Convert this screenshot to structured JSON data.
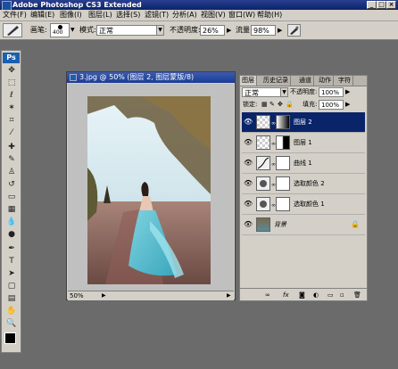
{
  "window": {
    "title": "Adobe Photoshop CS3 Extended"
  },
  "menu": [
    "文件(F)",
    "编辑(E)",
    "图像(I)",
    "图层(L)",
    "选择(S)",
    "滤镜(T)",
    "分析(A)",
    "视图(V)",
    "窗口(W)",
    "帮助(H)"
  ],
  "options": {
    "brush_label": "画笔:",
    "brush_size": "400",
    "mode_label": "模式:",
    "mode_value": "正常",
    "opacity_label": "不透明度:",
    "opacity_value": "26%",
    "flow_label": "流量:",
    "flow_value": "98%"
  },
  "toolbox": {
    "logo": "Ps"
  },
  "document": {
    "title": "3.jpg @ 50% (图层 2, 图层蒙版/8)",
    "zoom": "50%"
  },
  "layers_panel": {
    "tabs": [
      "图层",
      "历史记录",
      "通道",
      "动作",
      "字符"
    ],
    "blend_mode": "正常",
    "opacity_label": "不透明度:",
    "opacity_value": "100%",
    "lock_label": "锁定:",
    "fill_label": "填充:",
    "fill_value": "100%",
    "layers": [
      {
        "name": "图层 2",
        "selected": true
      },
      {
        "name": "图层 1",
        "selected": false
      },
      {
        "name": "曲线 1",
        "selected": false
      },
      {
        "name": "选取颜色 2",
        "selected": false
      },
      {
        "name": "选取颜色 1",
        "selected": false
      },
      {
        "name": "背景",
        "selected": false
      }
    ]
  },
  "colors": {
    "title_bar": "#0a246a",
    "selected_layer": "#0a246a",
    "panel": "#d4d0c8",
    "workspace": "#6b6b6b"
  }
}
